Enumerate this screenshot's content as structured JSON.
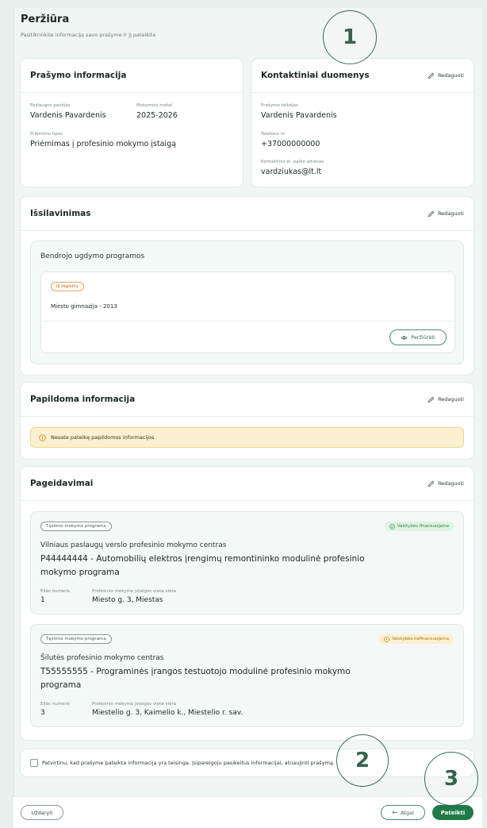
{
  "page": {
    "title": "Peržiūra",
    "subtitle": "Pasitikrinkite informaciją savo prašyme ir jį pateikite"
  },
  "application_info": {
    "title": "Prašymo informacija",
    "receiver_label": "Paslaugos gavėjas",
    "receiver_value": "Vardenis Pavardenis",
    "year_label": "Mokymosi metai",
    "year_value": "2025-2026",
    "type_label": "Priėmimo tipas",
    "type_value": "Priėmimas į profesinio mokymo įstaigą"
  },
  "contacts": {
    "title": "Kontaktiniai duomenys",
    "edit_label": "Redaguoti",
    "applicant_label": "Prašymo teikėjas",
    "applicant_value": "Vardenis Pavardenis",
    "phone_label": "Telefono nr.",
    "phone_value": "+37000000000",
    "email_label": "Kontaktinis el. pašto adresas",
    "email_value": "vardziukas@lt.lt"
  },
  "education": {
    "title": "Išsilavinimas",
    "edit_label": "Redaguoti",
    "group_title": "Bendrojo ugdymo programos",
    "badge": "Iš registrų",
    "school": "Miesto gimnazija - 2013",
    "view_label": "Peržiūrėti"
  },
  "additional": {
    "title": "Papildoma informacija",
    "edit_label": "Redaguoti",
    "warning": "Nesate pateikę papildomos informacijos"
  },
  "wishes": {
    "title": "Pageidavimai",
    "edit_label": "Redaguoti",
    "order_label": "Eilės numeris",
    "location_label": "Profesinio mokymo įstaigos vieta vieta",
    "items": [
      {
        "badge": "Tęstinio mokymo programa",
        "status": "Valstybės finansuojama",
        "school": "Vilniaus paslaugų verslo profesinio mokymo centras",
        "program_line1": "P44444444 - Automobilių elektros įrengimų remontininko modulinė profesinio",
        "program_line2": "mokymo programa",
        "order": "1",
        "location": "Miesto g. 3, Miestas",
        "status_color": "#2d8a4a"
      },
      {
        "badge": "Tęstinio mokymo programa",
        "status": "Valstybės nefinansuojama",
        "school": "Šilutės profesinio mokymo centras",
        "program_line1": "T55555555 - Programinės įrangos testuotojo modulinė profesinio mokymo",
        "program_line2": "programa",
        "order": "3",
        "location": "Miestelio g. 3, Kaimelio k., Miestelio r. sav.",
        "status_color": "#a27612"
      }
    ]
  },
  "confirm": {
    "text": "Patvirtinu, kad prašyme pateikta informacija yra teisinga. Įsipareigoju pasikeitus informacijai, atnaujinti prašymą."
  },
  "footer": {
    "close_label": "Uždaryti",
    "back_label": "Atgal",
    "submit_label": "Pateikti"
  },
  "annotations": {
    "one": "1",
    "two": "2",
    "three": "3"
  },
  "colors": {
    "primary": "#1f7a48",
    "accent_outline": "#4f8a6c",
    "warning_bg": "#fbf0cf",
    "page_bg": "#f1f5f3"
  }
}
